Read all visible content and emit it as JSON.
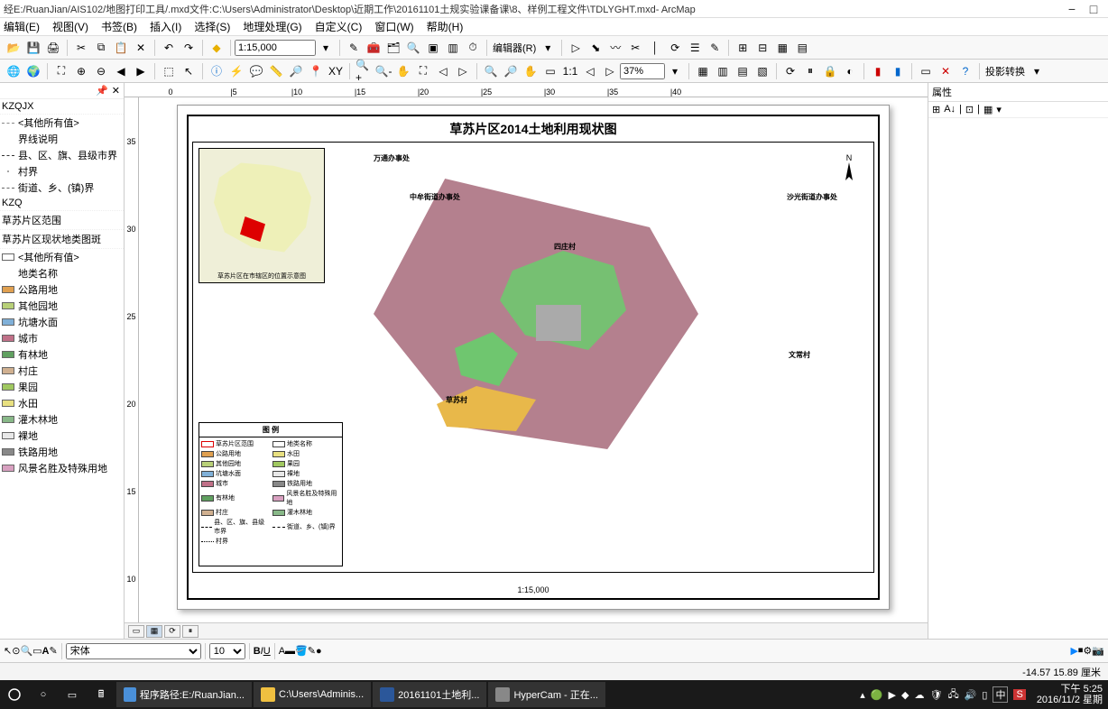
{
  "title": "经E:/RuanJian/AIS102/地图打印工具/.mxd文件:C:\\Users\\Administrator\\Desktop\\近期工作\\20161101土规实验课备课\\8、样例工程文件\\TDLYGHT.mxd- ArcMap",
  "menus": [
    "编辑(E)",
    "视图(V)",
    "书签(B)",
    "插入(I)",
    "选择(S)",
    "地理处理(G)",
    "自定义(C)",
    "窗口(W)",
    "帮助(H)"
  ],
  "scale_value": "1:15,000",
  "editor_label": "编辑器(R)",
  "zoom_pct": "37%",
  "proj_label": "投影转换",
  "toc": {
    "groups": [
      {
        "name": "KZQJX",
        "items": [
          {
            "label": "<其他所有值>",
            "type": "dash",
            "color": "#888"
          },
          {
            "label": "界线说明",
            "type": "text"
          },
          {
            "label": "县、区、旗、县级市界",
            "type": "dash",
            "color": "#333"
          },
          {
            "label": "村界",
            "type": "dot"
          },
          {
            "label": "街道、乡、(镇)界",
            "type": "dash",
            "color": "#666"
          }
        ]
      },
      {
        "name": "KZQ",
        "items": []
      },
      {
        "name": "草苏片区范围",
        "items": []
      },
      {
        "name": "草苏片区现状地类图斑",
        "items": [
          {
            "label": "<其他所有值>",
            "type": "sw",
            "color": "#fff"
          },
          {
            "label": "地类名称",
            "type": "text"
          },
          {
            "label": "公路用地",
            "type": "sw",
            "color": "#e0a050"
          },
          {
            "label": "其他园地",
            "type": "sw",
            "color": "#b8d078"
          },
          {
            "label": "坑塘水面",
            "type": "sw",
            "color": "#80b0d8"
          },
          {
            "label": "城市",
            "type": "sw",
            "color": "#c07088"
          },
          {
            "label": "有林地",
            "type": "sw",
            "color": "#60a060"
          },
          {
            "label": "村庄",
            "type": "sw",
            "color": "#d0b090"
          },
          {
            "label": "果园",
            "type": "sw",
            "color": "#a0c860"
          },
          {
            "label": "水田",
            "type": "sw",
            "color": "#e8e080"
          },
          {
            "label": "灌木林地",
            "type": "sw",
            "color": "#88b888"
          },
          {
            "label": "裸地",
            "type": "sw",
            "color": "#e8e8e8"
          },
          {
            "label": "铁路用地",
            "type": "sw",
            "color": "#888"
          },
          {
            "label": "风景名胜及特殊用地",
            "type": "sw",
            "color": "#d8a0c0"
          }
        ]
      }
    ]
  },
  "map": {
    "title": "草苏片区2014土地利用现状图",
    "scale": "1:15,000",
    "north": "N",
    "inset_caption": "草苏片区在市辖区的位置示意图",
    "legend_title": "图 例",
    "places": {
      "p1": "万通办事处",
      "p2": "中牟街道办事处",
      "p3": "沙光街道办事处",
      "p4": "四庄村",
      "p5": "文常村",
      "p6": "草苏村"
    },
    "legend_items": [
      {
        "label": "草苏片区范围",
        "color": "#fff",
        "border": "#d00"
      },
      {
        "label": "地类名称",
        "color": "#fff"
      },
      {
        "label": "公路用地",
        "color": "#e0a050"
      },
      {
        "label": "水田",
        "color": "#e8e080"
      },
      {
        "label": "其他园地",
        "color": "#b8d078"
      },
      {
        "label": "果园",
        "color": "#a0c860"
      },
      {
        "label": "坑塘水面",
        "color": "#80b0d8"
      },
      {
        "label": "裸地",
        "color": "#e8e8e8"
      },
      {
        "label": "城市",
        "color": "#c07088"
      },
      {
        "label": "铁路用地",
        "color": "#888"
      },
      {
        "label": "有林地",
        "color": "#60a060"
      },
      {
        "label": "风景名胜及特殊用地",
        "color": "#d8a0c0"
      },
      {
        "label": "村庄",
        "color": "#d0b090"
      },
      {
        "label": "灌木林地",
        "color": "#88b888"
      },
      {
        "label": "县、区、旗、县级市界",
        "type": "dash"
      },
      {
        "label": "街道、乡、(镇)界",
        "type": "dash"
      },
      {
        "label": "村界",
        "type": "dot"
      }
    ],
    "ruler_h": [
      "0",
      "|5",
      "|10",
      "|15",
      "|20",
      "|25",
      "|30",
      "|35",
      "|40"
    ],
    "ruler_v": [
      "35",
      "30",
      "25",
      "20",
      "15",
      "10"
    ]
  },
  "props_panel": "属性",
  "font_name": "宋体",
  "font_size": "10",
  "status": "-14.57  15.89 厘米",
  "taskbar": {
    "items": [
      {
        "label": "程序路径:E:/RuanJian...",
        "color": "#4a90d9"
      },
      {
        "label": "C:\\Users\\Adminis...",
        "color": "#f0c040"
      },
      {
        "label": "20161101土地利...",
        "color": "#2b579a"
      },
      {
        "label": "HyperCam - 正在...",
        "color": "#888"
      }
    ],
    "time": "下午 5:25",
    "date": "2016/11/2 星期",
    "ime": "中"
  }
}
